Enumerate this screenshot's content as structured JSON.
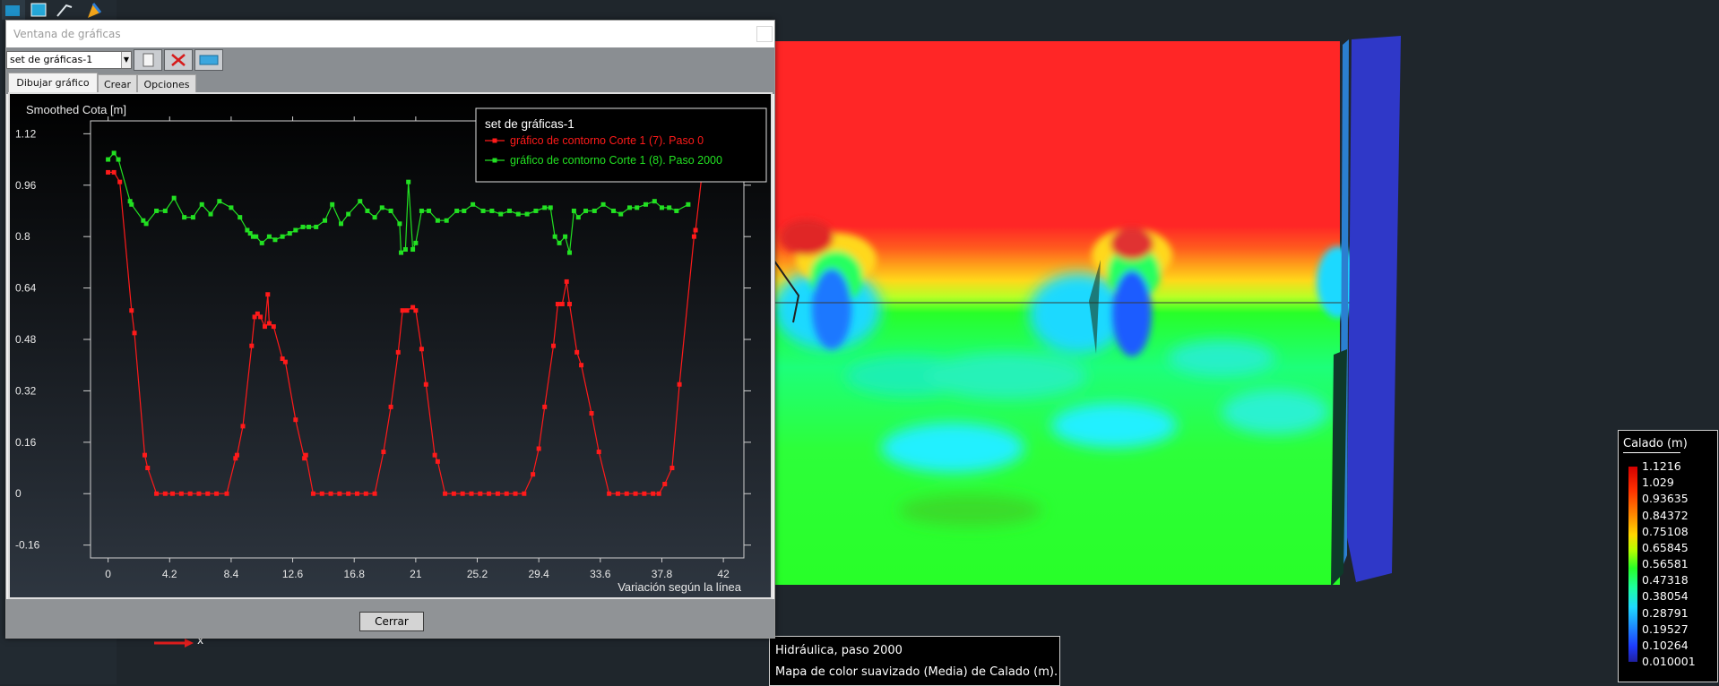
{
  "window": {
    "title": "Ventana de gráficas",
    "set_selector": "set de gráficas-1",
    "tabs": [
      "Dibujar gráfico",
      "Crear",
      "Opciones"
    ],
    "close_button": "Cerrar"
  },
  "chart_data": {
    "type": "line",
    "ylabel": "Smoothed Cota [m]",
    "xlabel": "Variación según la línea",
    "legend_title": "set de gráficas-1",
    "legend_placement": "top-right",
    "xlim": [
      -1.2,
      43.4
    ],
    "ylim": [
      -0.2,
      1.16
    ],
    "x_ticks": [
      "0",
      "4.2",
      "8.4",
      "12.6",
      "16.8",
      "21",
      "25.2",
      "29.4",
      "33.6",
      "37.8",
      "42"
    ],
    "y_ticks": [
      "1.12",
      "0.96",
      "0.8",
      "0.64",
      "0.48",
      "0.32",
      "0.16",
      "0",
      "-0.16"
    ],
    "series": [
      {
        "name": "gráfico de contorno Corte 1 (7). Paso 0",
        "color": "#ff1a1a",
        "points": [
          [
            0,
            1.0
          ],
          [
            0.4,
            1.0
          ],
          [
            0.8,
            0.97
          ],
          [
            1.6,
            0.57
          ],
          [
            1.8,
            0.5
          ],
          [
            2.5,
            0.12
          ],
          [
            2.7,
            0.08
          ],
          [
            3.3,
            0.0
          ],
          [
            3.9,
            0.0
          ],
          [
            4.4,
            0.0
          ],
          [
            5.0,
            0.0
          ],
          [
            5.6,
            0.0
          ],
          [
            6.2,
            0.0
          ],
          [
            6.8,
            0.0
          ],
          [
            7.4,
            0.0
          ],
          [
            8.1,
            0.0
          ],
          [
            8.7,
            0.11
          ],
          [
            8.8,
            0.12
          ],
          [
            9.2,
            0.21
          ],
          [
            9.8,
            0.46
          ],
          [
            10.0,
            0.55
          ],
          [
            10.2,
            0.56
          ],
          [
            10.4,
            0.55
          ],
          [
            10.7,
            0.52
          ],
          [
            10.9,
            0.62
          ],
          [
            11.0,
            0.53
          ],
          [
            11.3,
            0.52
          ],
          [
            11.9,
            0.42
          ],
          [
            12.1,
            0.41
          ],
          [
            12.8,
            0.23
          ],
          [
            13.4,
            0.11
          ],
          [
            13.5,
            0.12
          ],
          [
            14.0,
            0.0
          ],
          [
            14.6,
            0.0
          ],
          [
            15.2,
            0.0
          ],
          [
            15.8,
            0.0
          ],
          [
            16.4,
            0.0
          ],
          [
            17.0,
            0.0
          ],
          [
            17.6,
            0.0
          ],
          [
            18.2,
            0.0
          ],
          [
            18.8,
            0.13
          ],
          [
            19.3,
            0.27
          ],
          [
            19.8,
            0.44
          ],
          [
            20.1,
            0.57
          ],
          [
            20.4,
            0.57
          ],
          [
            20.8,
            0.58
          ],
          [
            21.0,
            0.57
          ],
          [
            21.4,
            0.45
          ],
          [
            21.7,
            0.34
          ],
          [
            22.3,
            0.12
          ],
          [
            22.5,
            0.1
          ],
          [
            23.0,
            0.0
          ],
          [
            23.6,
            0.0
          ],
          [
            24.2,
            0.0
          ],
          [
            24.8,
            0.0
          ],
          [
            25.4,
            0.0
          ],
          [
            26.0,
            0.0
          ],
          [
            26.6,
            0.0
          ],
          [
            27.2,
            0.0
          ],
          [
            27.8,
            0.0
          ],
          [
            28.4,
            0.0
          ],
          [
            29.0,
            0.06
          ],
          [
            29.4,
            0.14
          ],
          [
            29.8,
            0.27
          ],
          [
            30.4,
            0.46
          ],
          [
            30.7,
            0.59
          ],
          [
            31.0,
            0.59
          ],
          [
            31.3,
            0.66
          ],
          [
            31.5,
            0.59
          ],
          [
            32.0,
            0.44
          ],
          [
            32.3,
            0.4
          ],
          [
            33.0,
            0.25
          ],
          [
            33.5,
            0.13
          ],
          [
            34.2,
            0.0
          ],
          [
            34.8,
            0.0
          ],
          [
            35.4,
            0.0
          ],
          [
            36.0,
            0.0
          ],
          [
            36.6,
            0.0
          ],
          [
            37.2,
            0.0
          ],
          [
            37.6,
            0.0
          ],
          [
            38.0,
            0.03
          ],
          [
            38.5,
            0.08
          ],
          [
            39.0,
            0.34
          ],
          [
            40.0,
            0.8
          ],
          [
            40.1,
            0.82
          ],
          [
            40.8,
            1.1
          ]
        ]
      },
      {
        "name": "gráfico de contorno Corte 1 (8). Paso 2000",
        "color": "#22e022",
        "points": [
          [
            0,
            1.04
          ],
          [
            0.4,
            1.06
          ],
          [
            0.7,
            1.04
          ],
          [
            1.5,
            0.91
          ],
          [
            1.6,
            0.9
          ],
          [
            2.4,
            0.85
          ],
          [
            2.6,
            0.84
          ],
          [
            3.3,
            0.88
          ],
          [
            3.9,
            0.88
          ],
          [
            4.5,
            0.92
          ],
          [
            5.2,
            0.86
          ],
          [
            5.8,
            0.86
          ],
          [
            6.4,
            0.9
          ],
          [
            7.0,
            0.87
          ],
          [
            7.6,
            0.91
          ],
          [
            8.4,
            0.89
          ],
          [
            9.0,
            0.86
          ],
          [
            9.5,
            0.82
          ],
          [
            9.7,
            0.81
          ],
          [
            9.9,
            0.8
          ],
          [
            10.1,
            0.8
          ],
          [
            10.5,
            0.78
          ],
          [
            11.0,
            0.8
          ],
          [
            11.4,
            0.79
          ],
          [
            11.9,
            0.8
          ],
          [
            12.4,
            0.81
          ],
          [
            12.8,
            0.82
          ],
          [
            13.3,
            0.83
          ],
          [
            13.7,
            0.83
          ],
          [
            14.2,
            0.83
          ],
          [
            14.8,
            0.85
          ],
          [
            15.3,
            0.9
          ],
          [
            15.9,
            0.84
          ],
          [
            16.4,
            0.87
          ],
          [
            17.2,
            0.91
          ],
          [
            17.7,
            0.88
          ],
          [
            18.2,
            0.86
          ],
          [
            18.7,
            0.89
          ],
          [
            19.3,
            0.88
          ],
          [
            19.9,
            0.84
          ],
          [
            20.0,
            0.75
          ],
          [
            20.3,
            0.76
          ],
          [
            20.5,
            0.97
          ],
          [
            20.8,
            0.76
          ],
          [
            21.0,
            0.78
          ],
          [
            21.4,
            0.88
          ],
          [
            21.9,
            0.88
          ],
          [
            22.5,
            0.85
          ],
          [
            23.1,
            0.85
          ],
          [
            23.8,
            0.88
          ],
          [
            24.3,
            0.88
          ],
          [
            24.9,
            0.9
          ],
          [
            25.6,
            0.88
          ],
          [
            26.2,
            0.88
          ],
          [
            26.8,
            0.87
          ],
          [
            27.4,
            0.88
          ],
          [
            28.0,
            0.87
          ],
          [
            28.6,
            0.87
          ],
          [
            29.2,
            0.88
          ],
          [
            29.8,
            0.89
          ],
          [
            30.2,
            0.89
          ],
          [
            30.5,
            0.8
          ],
          [
            30.8,
            0.78
          ],
          [
            31.2,
            0.8
          ],
          [
            31.5,
            0.75
          ],
          [
            31.8,
            0.88
          ],
          [
            32.1,
            0.86
          ],
          [
            32.6,
            0.88
          ],
          [
            33.2,
            0.88
          ],
          [
            33.8,
            0.9
          ],
          [
            34.5,
            0.88
          ],
          [
            35.0,
            0.87
          ],
          [
            35.6,
            0.89
          ],
          [
            36.1,
            0.89
          ],
          [
            36.7,
            0.9
          ],
          [
            37.3,
            0.91
          ],
          [
            37.8,
            0.89
          ],
          [
            38.3,
            0.89
          ],
          [
            38.8,
            0.88
          ],
          [
            39.6,
            0.9
          ]
        ]
      }
    ]
  },
  "viewport": {
    "info_line1": "Hidráulica, paso 2000",
    "info_line2": "Mapa de color suavizado (Media) de Calado (m).",
    "legend_title": "Calado (m)",
    "legend_values": [
      "1.1216",
      "1.029",
      "0.93635",
      "0.84372",
      "0.75108",
      "0.65845",
      "0.56581",
      "0.47318",
      "0.38054",
      "0.28791",
      "0.19527",
      "0.10264",
      "0.010001"
    ],
    "axis_glyph_label": "x"
  }
}
